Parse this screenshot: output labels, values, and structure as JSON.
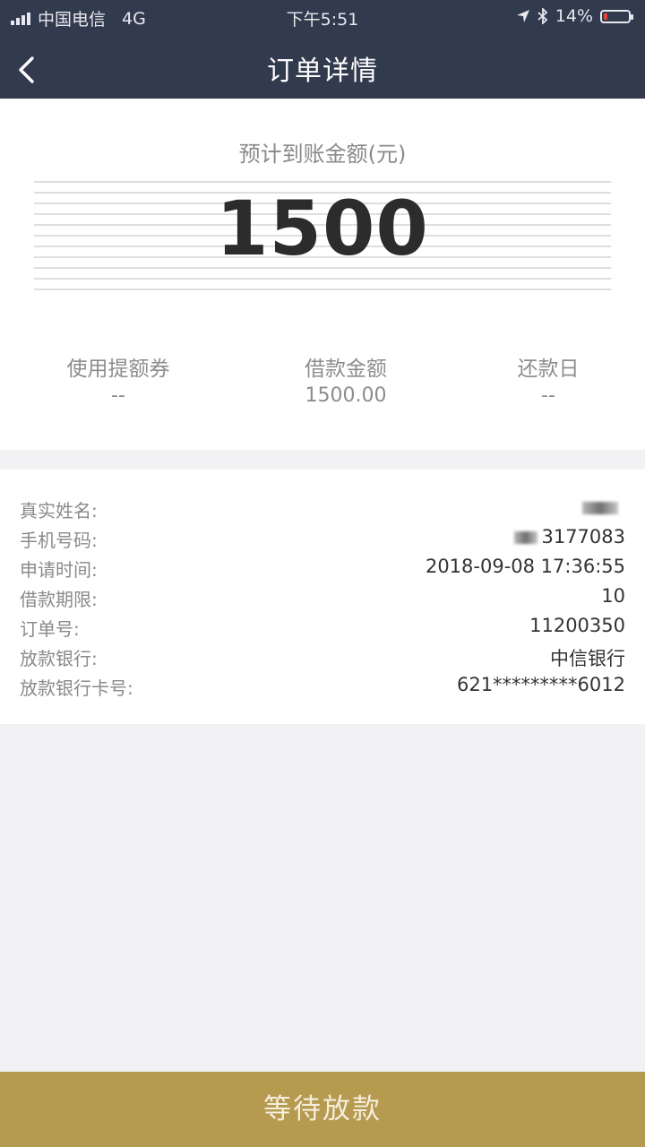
{
  "status_bar": {
    "carrier": "中国电信",
    "network": "4G",
    "time": "下午5:51",
    "battery": "14%",
    "battery_level": 0.14
  },
  "header": {
    "title": "订单详情"
  },
  "amount": {
    "label": "预计到账金额(元)",
    "value": "1500"
  },
  "stats": [
    {
      "label": "使用提额券",
      "value": "--"
    },
    {
      "label": "借款金额",
      "value": "1500.00"
    },
    {
      "label": "还款日",
      "value": "--"
    }
  ],
  "details": [
    {
      "label": "真实姓名:",
      "value": ""
    },
    {
      "label": "手机号码:",
      "value": "3177083"
    },
    {
      "label": "申请时间:",
      "value": "2018-09-08 17:36:55"
    },
    {
      "label": "借款期限:",
      "value": "10"
    },
    {
      "label": "订单号:",
      "value": "11200350"
    },
    {
      "label": "放款银行:",
      "value": "中信银行"
    },
    {
      "label": "放款银行卡号:",
      "value": "621*********6012"
    }
  ],
  "bottom_button": {
    "label": "等待放款"
  },
  "colors": {
    "header_bg": "#323a4e",
    "button_bg": "#b59a50",
    "battery_low": "#e4453a"
  }
}
